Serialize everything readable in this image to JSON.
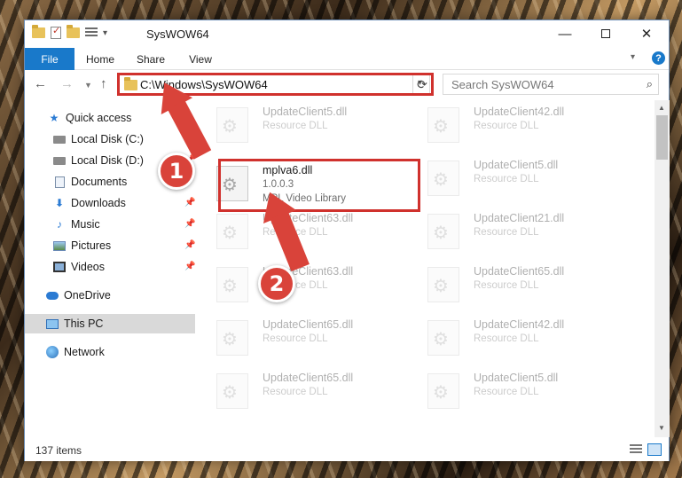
{
  "window": {
    "title": "SysWOW64"
  },
  "titlebar": {
    "minimize": "—",
    "close": "✕"
  },
  "ribbon": {
    "tabs": [
      "File",
      "Home",
      "Share",
      "View"
    ],
    "help": "?"
  },
  "address": {
    "path": "C:\\Windows\\SysWOW64"
  },
  "search": {
    "placeholder": "Search SysWOW64"
  },
  "sidebar": {
    "items": [
      {
        "label": "Quick access",
        "icon": "star-icon"
      },
      {
        "label": "Local Disk (C:)",
        "icon": "disk-icon"
      },
      {
        "label": "Local Disk (D:)",
        "icon": "disk-icon"
      },
      {
        "label": "Documents",
        "icon": "document-icon"
      },
      {
        "label": "Downloads",
        "icon": "download-icon"
      },
      {
        "label": "Music",
        "icon": "music-icon"
      },
      {
        "label": "Pictures",
        "icon": "pictures-icon"
      },
      {
        "label": "Videos",
        "icon": "video-icon"
      },
      {
        "label": "OneDrive",
        "icon": "cloud-icon"
      },
      {
        "label": "This PC",
        "icon": "computer-icon"
      },
      {
        "label": "Network",
        "icon": "network-icon"
      }
    ]
  },
  "files": {
    "left": [
      {
        "name": "UpdateClient5.dll",
        "line2": "Resource DLL"
      },
      {
        "name": "mplva6.dll",
        "line2": "1.0.0.3",
        "line3": "MPL Video Library"
      },
      {
        "name": "UpdateClient63.dll",
        "line2": "Resource DLL"
      },
      {
        "name": "UpdateClient63.dll",
        "line2": "Resource DLL"
      },
      {
        "name": "UpdateClient65.dll",
        "line2": "Resource DLL"
      },
      {
        "name": "UpdateClient65.dll",
        "line2": "Resource DLL"
      }
    ],
    "right": [
      {
        "name": "UpdateClient42.dll",
        "line2": "Resource DLL"
      },
      {
        "name": "UpdateClient5.dll",
        "line2": "Resource DLL"
      },
      {
        "name": "UpdateClient21.dll",
        "line2": "Resource DLL"
      },
      {
        "name": "UpdateClient65.dll",
        "line2": "Resource DLL"
      },
      {
        "name": "UpdateClient42.dll",
        "line2": "Resource DLL"
      },
      {
        "name": "UpdateClient5.dll",
        "line2": "Resource DLL"
      }
    ]
  },
  "status": {
    "item_count": "137 items"
  },
  "callouts": {
    "step1": "1",
    "step2": "2"
  },
  "colors": {
    "accent": "#1979ca",
    "highlight": "#d0312d"
  }
}
